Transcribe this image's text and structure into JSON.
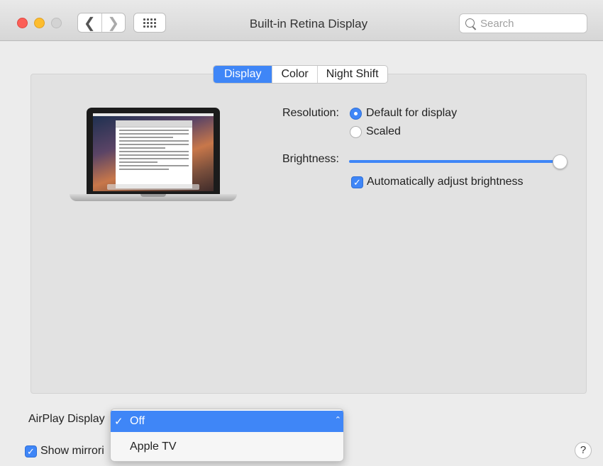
{
  "window": {
    "title": "Built-in Retina Display",
    "search_placeholder": "Search",
    "back_glyph": "❮",
    "forward_glyph": "❯"
  },
  "tabs": [
    {
      "label": "Display",
      "active": true
    },
    {
      "label": "Color",
      "active": false
    },
    {
      "label": "Night Shift",
      "active": false
    }
  ],
  "resolution": {
    "label": "Resolution:",
    "options": [
      {
        "label": "Default for display",
        "selected": true
      },
      {
        "label": "Scaled",
        "selected": false
      }
    ]
  },
  "brightness": {
    "label": "Brightness:",
    "value_fraction": 0.98,
    "auto_adjust_label": "Automatically adjust brightness",
    "auto_adjust_checked": true
  },
  "airplay": {
    "label": "AirPlay Display",
    "options": [
      {
        "label": "Off",
        "selected": true
      },
      {
        "label": "Apple TV",
        "selected": false
      }
    ]
  },
  "mirroring": {
    "label": "Show mirrori",
    "checked": true
  },
  "help_label": "?",
  "colors": {
    "accent": "#3f86f7",
    "close": "#fc5f57",
    "minimize": "#fdbd2e"
  }
}
